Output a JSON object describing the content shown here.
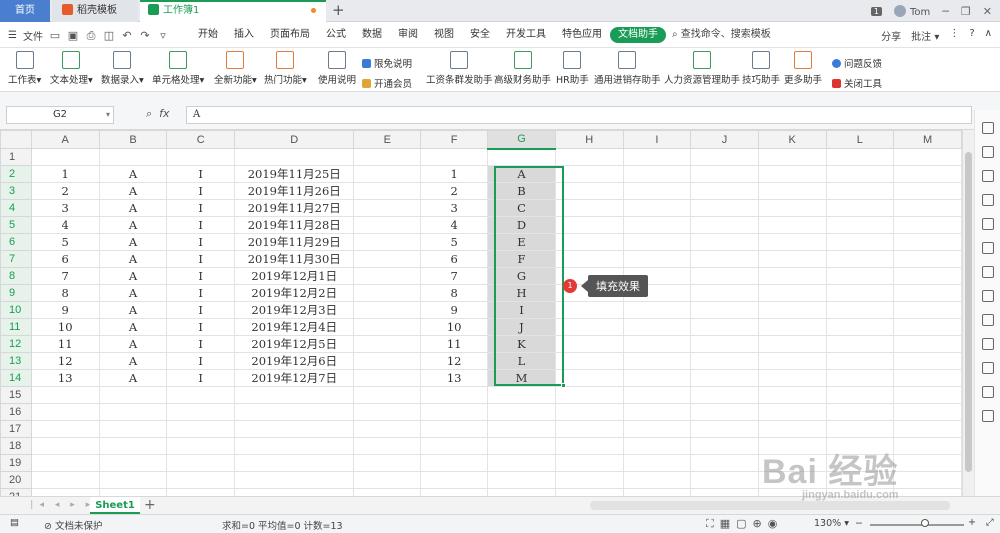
{
  "tabbar": {
    "home": "首页",
    "daoke": "稻壳模板",
    "workbook": "工作簿1",
    "add": "+",
    "badge": "1",
    "user": "Tom"
  },
  "menubar": {
    "file": "文件",
    "tabs": [
      "开始",
      "插入",
      "页面布局",
      "公式",
      "数据",
      "审阅",
      "视图",
      "安全",
      "开发工具",
      "特色应用",
      "文档助手"
    ],
    "active_tab": "文档助手",
    "search": "查找命令、搜索模板",
    "share": "分享",
    "annotate": "批注"
  },
  "ribbon": {
    "buttons": [
      "工作表",
      "文本处理",
      "数据录入",
      "单元格处理",
      "全新功能",
      "热门功能",
      "使用说明"
    ],
    "small1": "限免说明",
    "small2": "开通会员",
    "tools": [
      "工资条群发助手",
      "高级财务助手",
      "HR助手",
      "通用进销存助手",
      "人力资源管理助手",
      "技巧助手",
      "更多助手"
    ],
    "feedback": "问题反馈",
    "close_tool": "关闭工具"
  },
  "formula": {
    "cell_ref": "G2",
    "fx": "fx",
    "value": "A"
  },
  "grid": {
    "columns": [
      "A",
      "B",
      "C",
      "D",
      "E",
      "F",
      "G",
      "H",
      "I",
      "J",
      "K",
      "L",
      "M"
    ],
    "selected_column": "G",
    "rows": [
      [
        "1",
        "A",
        "I",
        "2019年11月25日",
        "",
        "1",
        "A"
      ],
      [
        "2",
        "A",
        "I",
        "2019年11月26日",
        "",
        "2",
        "B"
      ],
      [
        "3",
        "A",
        "I",
        "2019年11月27日",
        "",
        "3",
        "C"
      ],
      [
        "4",
        "A",
        "I",
        "2019年11月28日",
        "",
        "4",
        "D"
      ],
      [
        "5",
        "A",
        "I",
        "2019年11月29日",
        "",
        "5",
        "E"
      ],
      [
        "6",
        "A",
        "I",
        "2019年11月30日",
        "",
        "6",
        "F"
      ],
      [
        "7",
        "A",
        "I",
        "2019年12月1日",
        "",
        "7",
        "G"
      ],
      [
        "8",
        "A",
        "I",
        "2019年12月2日",
        "",
        "8",
        "H"
      ],
      [
        "9",
        "A",
        "I",
        "2019年12月3日",
        "",
        "9",
        "I"
      ],
      [
        "10",
        "A",
        "I",
        "2019年12月4日",
        "",
        "10",
        "J"
      ],
      [
        "11",
        "A",
        "I",
        "2019年12月5日",
        "",
        "11",
        "K"
      ],
      [
        "12",
        "A",
        "I",
        "2019年12月6日",
        "",
        "12",
        "L"
      ],
      [
        "13",
        "A",
        "I",
        "2019年12月7日",
        "",
        "13",
        "M"
      ]
    ],
    "row_count": 21
  },
  "callout": {
    "number": "1",
    "text": "填充效果"
  },
  "sheetbar": {
    "sheet": "Sheet1",
    "add": "+"
  },
  "status": {
    "protect": "文档未保护",
    "summary": "求和=0  平均值=0  计数=13",
    "zoom": "130%"
  },
  "watermark": {
    "main": "Bai 经验",
    "sub": "jingyan.baidu.com"
  }
}
